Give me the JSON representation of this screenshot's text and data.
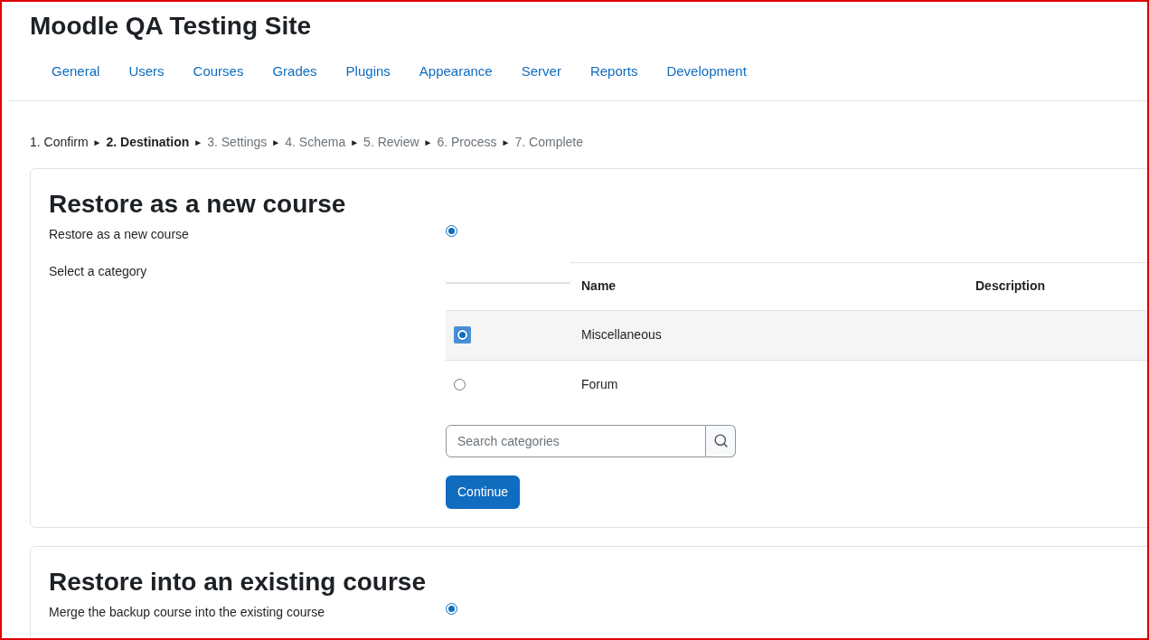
{
  "site_title": "Moodle QA Testing Site",
  "nav_tabs": [
    {
      "label": "General",
      "selected": false
    },
    {
      "label": "Users",
      "selected": false
    },
    {
      "label": "Courses",
      "selected": false
    },
    {
      "label": "Grades",
      "selected": false
    },
    {
      "label": "Plugins",
      "selected": false
    },
    {
      "label": "Appearance",
      "selected": false
    },
    {
      "label": "Server",
      "selected": false
    },
    {
      "label": "Reports",
      "selected": false
    },
    {
      "label": "Development",
      "selected": false
    }
  ],
  "steps": [
    {
      "label": "1. Confirm",
      "kind": "done"
    },
    {
      "label": "2. Destination",
      "kind": "current"
    },
    {
      "label": "3. Settings",
      "kind": "todo"
    },
    {
      "label": "4. Schema",
      "kind": "todo"
    },
    {
      "label": "5. Review",
      "kind": "todo"
    },
    {
      "label": "6. Process",
      "kind": "todo"
    },
    {
      "label": "7. Complete",
      "kind": "todo"
    }
  ],
  "step_separator": "►",
  "new_course": {
    "heading": "Restore as a new course",
    "option_label": "Restore as a new course",
    "option_selected": true,
    "category_label": "Select a category",
    "table": {
      "columns": [
        "Name",
        "Description"
      ],
      "rows": [
        {
          "name": "Miscellaneous",
          "selected": true
        },
        {
          "name": "Forum",
          "selected": false
        }
      ]
    },
    "search": {
      "placeholder": "Search categories"
    },
    "button": "Continue"
  },
  "existing_course": {
    "heading": "Restore into an existing course",
    "option_label": "Merge the backup course into the existing course",
    "option_selected": true
  }
}
